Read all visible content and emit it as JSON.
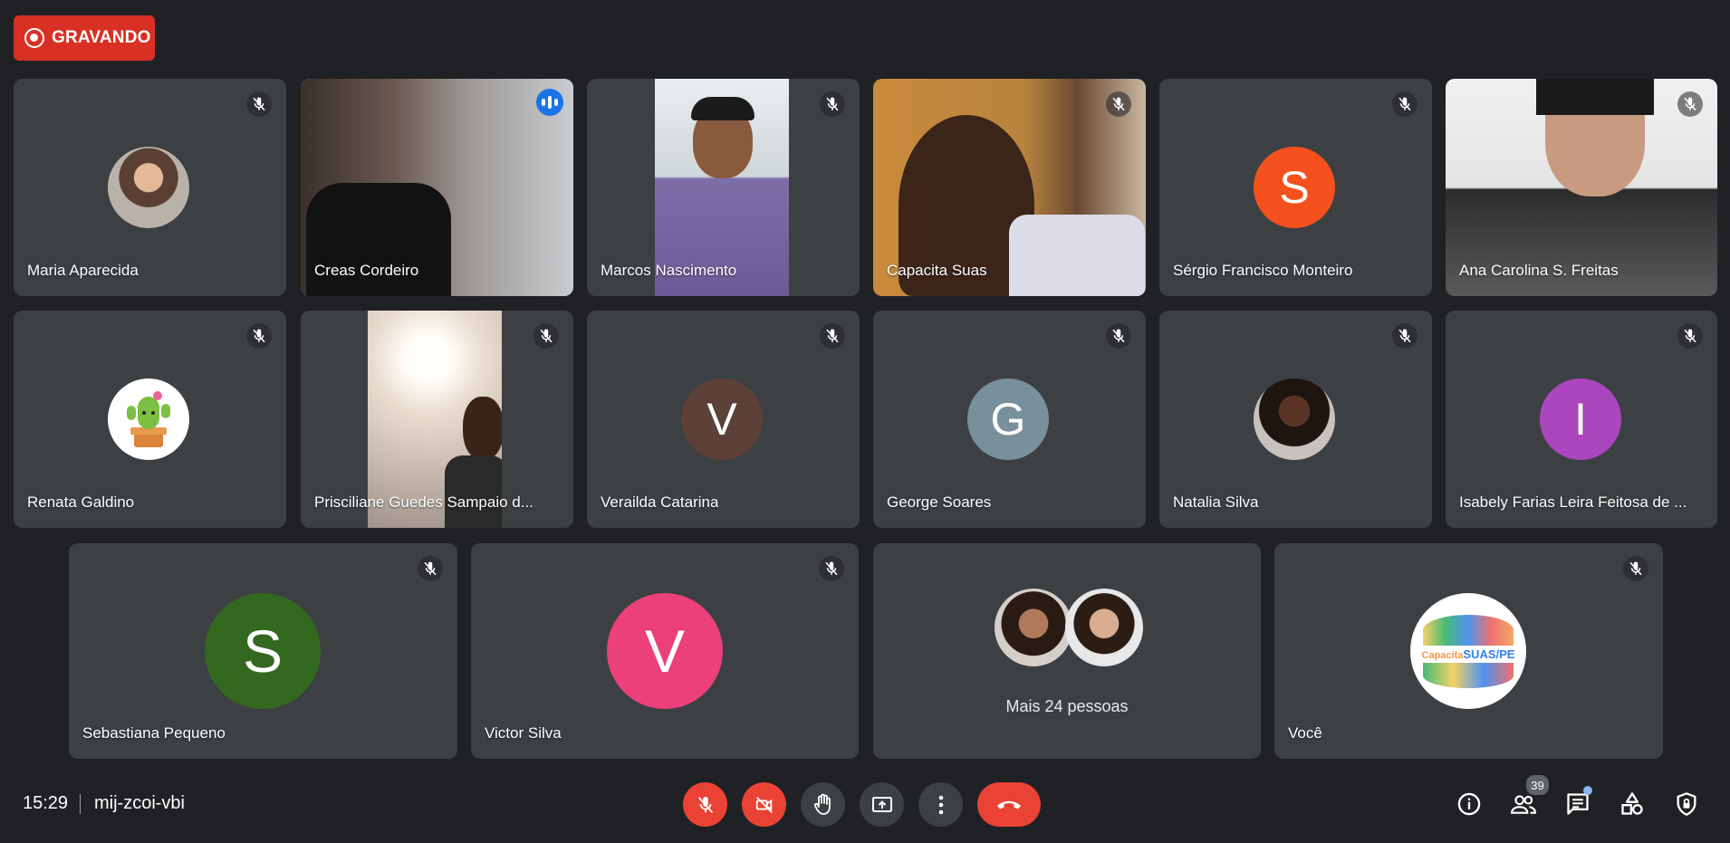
{
  "recording": {
    "label": "GRAVANDO"
  },
  "participants": [
    {
      "name": "Maria Aparecida",
      "kind": "photo-avatar",
      "muted": true
    },
    {
      "name": "Creas Cordeiro",
      "kind": "video",
      "speaking": true
    },
    {
      "name": "Marcos Nascimento",
      "kind": "video",
      "muted": true
    },
    {
      "name": "Capacita Suas",
      "kind": "video",
      "muted": true
    },
    {
      "name": "Sérgio Francisco Monteiro",
      "kind": "initial",
      "initial": "S",
      "color": "#f4511e",
      "muted": true
    },
    {
      "name": "Ana Carolina S. Freitas",
      "kind": "video",
      "muted": true
    },
    {
      "name": "Renata Galdino",
      "kind": "photo-avatar",
      "muted": true
    },
    {
      "name": "Prisciliane Guedes Sampaio d...",
      "kind": "video",
      "muted": true
    },
    {
      "name": "Verailda Catarina",
      "kind": "initial",
      "initial": "V",
      "color": "#5d4037",
      "muted": true
    },
    {
      "name": "George Soares",
      "kind": "initial",
      "initial": "G",
      "color": "#78909c",
      "muted": true
    },
    {
      "name": "Natalia Silva",
      "kind": "photo-avatar",
      "muted": true
    },
    {
      "name": "Isabely Farias Leira Feitosa de ...",
      "kind": "initial",
      "initial": "I",
      "color": "#ab47bc",
      "muted": true
    },
    {
      "name": "Sebastiana Pequeno",
      "kind": "initial",
      "initial": "S",
      "color": "#33691e",
      "muted": true
    },
    {
      "name": "Victor Silva",
      "kind": "initial",
      "initial": "V",
      "color": "#ec407a",
      "muted": true
    },
    {
      "name": "Você",
      "kind": "logo-avatar",
      "muted": true
    }
  ],
  "more_people": {
    "label": "Mais 24 pessoas"
  },
  "logo": {
    "text_left": "Capacita",
    "text_right": "SUAS/PE"
  },
  "bottom_bar": {
    "time": "15:29",
    "meeting_code": "mij-zcoi-vbi",
    "controls": [
      "mic-off-icon",
      "camera-off-icon",
      "raise-hand-icon",
      "present-icon",
      "more-options-icon",
      "end-call-icon"
    ],
    "right_icons": [
      "info-icon",
      "people-icon",
      "chat-icon",
      "activities-icon",
      "host-controls-icon"
    ],
    "people_count": "39"
  },
  "colors": {
    "background": "#202124",
    "tile": "#3c4043",
    "accent": "#8ab4f8",
    "danger": "#ea4335"
  }
}
